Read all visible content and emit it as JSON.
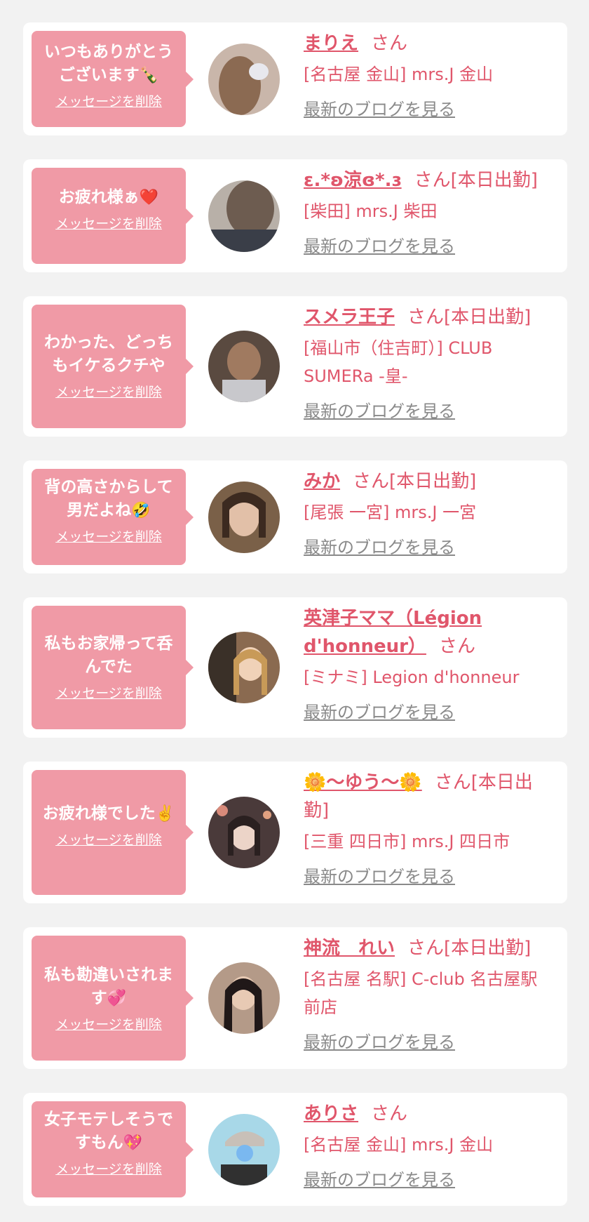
{
  "colors": {
    "background": "#f2f2f2",
    "card": "#ffffff",
    "bubble": "#f09aa6",
    "accent": "#e0566b",
    "link_gray": "#8a8a8a"
  },
  "delete_label": "メッセージを削除",
  "blog_label": "最新のブログを見る",
  "entries": [
    {
      "message": "いつもありがとう\nございます",
      "emoji": "🍾",
      "name": "まりえ",
      "suffix": "さん",
      "shop": "[名古屋 金山] mrs.J 金山"
    },
    {
      "message": "お疲れ様ぁ",
      "emoji": "❤️",
      "name": "ε.*ʚ涼ɞ*.ɜ",
      "suffix": "さん[本日出勤]",
      "shop": "[柴田] mrs.J 柴田"
    },
    {
      "message": "わかった、どっち\nもイケるクチや",
      "emoji": "",
      "name": "スメラ王子",
      "suffix": "さん[本日出勤]",
      "shop": "[福山市（住吉町）] CLUB SUMERa -皇-"
    },
    {
      "message": "背の高さからして\n男だよね",
      "emoji": "🤣",
      "name": "みか",
      "suffix": "さん[本日出勤]",
      "shop": "[尾張 一宮] mrs.J 一宮"
    },
    {
      "message": "私もお家帰って呑\nんでた",
      "emoji": "",
      "name": "英津子ママ（Légion d'honneur）",
      "suffix": "さん",
      "shop": "[ミナミ] Legion d'honneur"
    },
    {
      "message": "お疲れ様でした",
      "emoji": "✌️",
      "name": "🌼〜ゆう〜🌼",
      "suffix": "さん[本日出勤]",
      "shop": "[三重 四日市] mrs.J 四日市"
    },
    {
      "message": "私も勘違いされま\nす",
      "emoji": "💞",
      "name": "神流　れい",
      "suffix": "さん[本日出勤]",
      "shop": "[名古屋 名駅] C-club 名古屋駅前店"
    },
    {
      "message": "女子モテしそうで\nすもん",
      "emoji": "💖",
      "name": "ありさ",
      "suffix": "さん",
      "shop": "[名古屋 金山] mrs.J 金山"
    }
  ]
}
